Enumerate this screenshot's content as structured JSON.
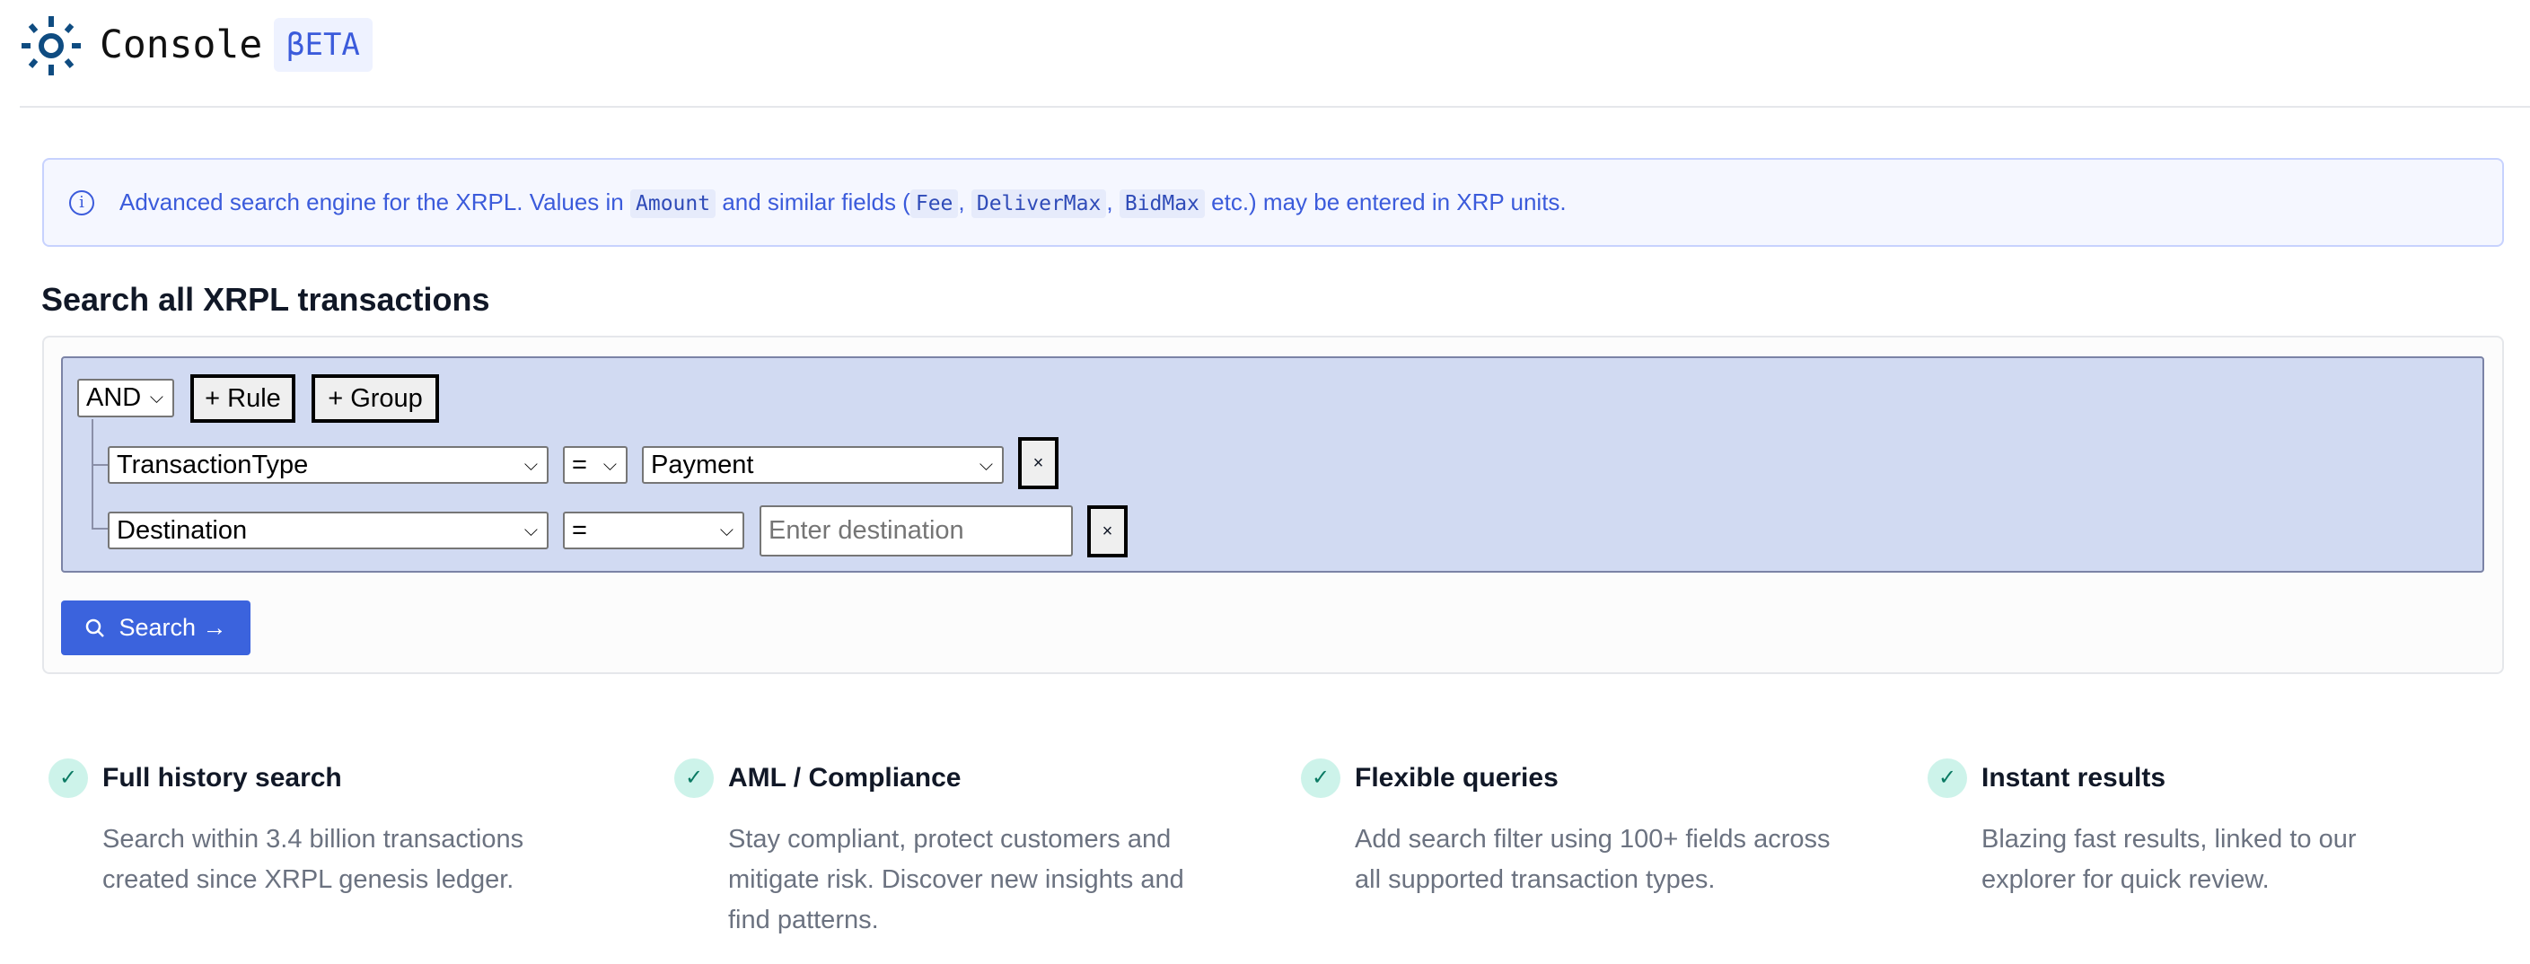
{
  "header": {
    "brand": "Console",
    "badge": "βETA",
    "logo_icon": "sun-logo-icon"
  },
  "info": {
    "icon": "info-icon",
    "text_1": "Advanced search engine for the XRPL. Values in",
    "code_amount": "Amount",
    "text_2": "and similar fields (",
    "code_fee": "Fee",
    "sep1": ",",
    "code_delivermax": "DeliverMax",
    "sep2": ",",
    "code_bidmax": "BidMax",
    "text_3": "etc.) may be entered in XRP units."
  },
  "search": {
    "heading": "Search all XRPL transactions",
    "combinator": "AND",
    "add_rule": "+ Rule",
    "add_group": "+ Group",
    "rules": [
      {
        "field": "TransactionType",
        "operator": "=",
        "value": "Payment",
        "remove": "×"
      },
      {
        "field": "Destination",
        "operator": "=",
        "value_placeholder": "Enter destination",
        "remove": "×"
      }
    ],
    "search_button": "Search →"
  },
  "features": [
    {
      "title": "Full history search",
      "desc": "Search within 3.4 billion transactions created since XRPL genesis ledger."
    },
    {
      "title": "AML / Compliance",
      "desc": "Stay compliant, protect customers and mitigate risk. Discover new insights and find patterns."
    },
    {
      "title": "Flexible queries",
      "desc": "Add search filter using 100+ fields across all supported transaction types."
    },
    {
      "title": "Instant results",
      "desc": "Blazing fast results, linked to our explorer for quick review."
    }
  ],
  "colors": {
    "accent": "#3b63dd",
    "builder_bg": "#d1daf2",
    "check_bg": "#cdf3ea"
  }
}
